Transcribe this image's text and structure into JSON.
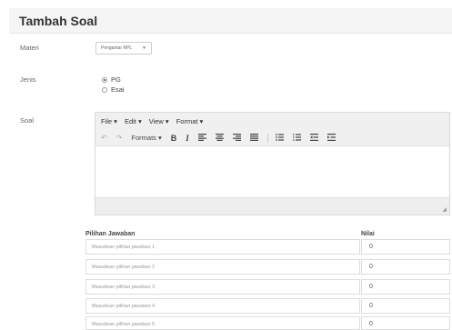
{
  "page_title": "Tambah Soal",
  "form": {
    "materi_label": "Materi",
    "materi_value": "Pengantar RPL",
    "jenis_label": "Jenis",
    "jenis_options": [
      {
        "label": "PG",
        "checked": true
      },
      {
        "label": "Esai",
        "checked": false
      }
    ],
    "soal_label": "Soal"
  },
  "editor": {
    "menus": [
      "File ▾",
      "Edit ▾",
      "View ▾",
      "Format ▾"
    ],
    "formats_label": "Formats ▾",
    "icons": [
      "undo-icon",
      "redo-icon",
      "bold-icon",
      "italic-icon",
      "align-left-icon",
      "align-center-icon",
      "align-right-icon",
      "align-justify-icon",
      "bullet-list-icon",
      "numbered-list-icon",
      "outdent-icon",
      "indent-icon"
    ]
  },
  "answers": {
    "header_choice": "Pilihan Jawaban",
    "header_score": "Nilai",
    "rows": [
      {
        "placeholder": "Masukkan pilihan jawaban 1",
        "score": "0"
      },
      {
        "placeholder": "Masukkan pilihan jawaban 2",
        "score": "0"
      },
      {
        "placeholder": "Masukkan pilihan jawaban 3",
        "score": "0"
      },
      {
        "placeholder": "Masukkan pilihan jawaban 4",
        "score": "0"
      },
      {
        "placeholder": "Masukkan pilihan jawaban 5",
        "score": "0"
      }
    ]
  }
}
